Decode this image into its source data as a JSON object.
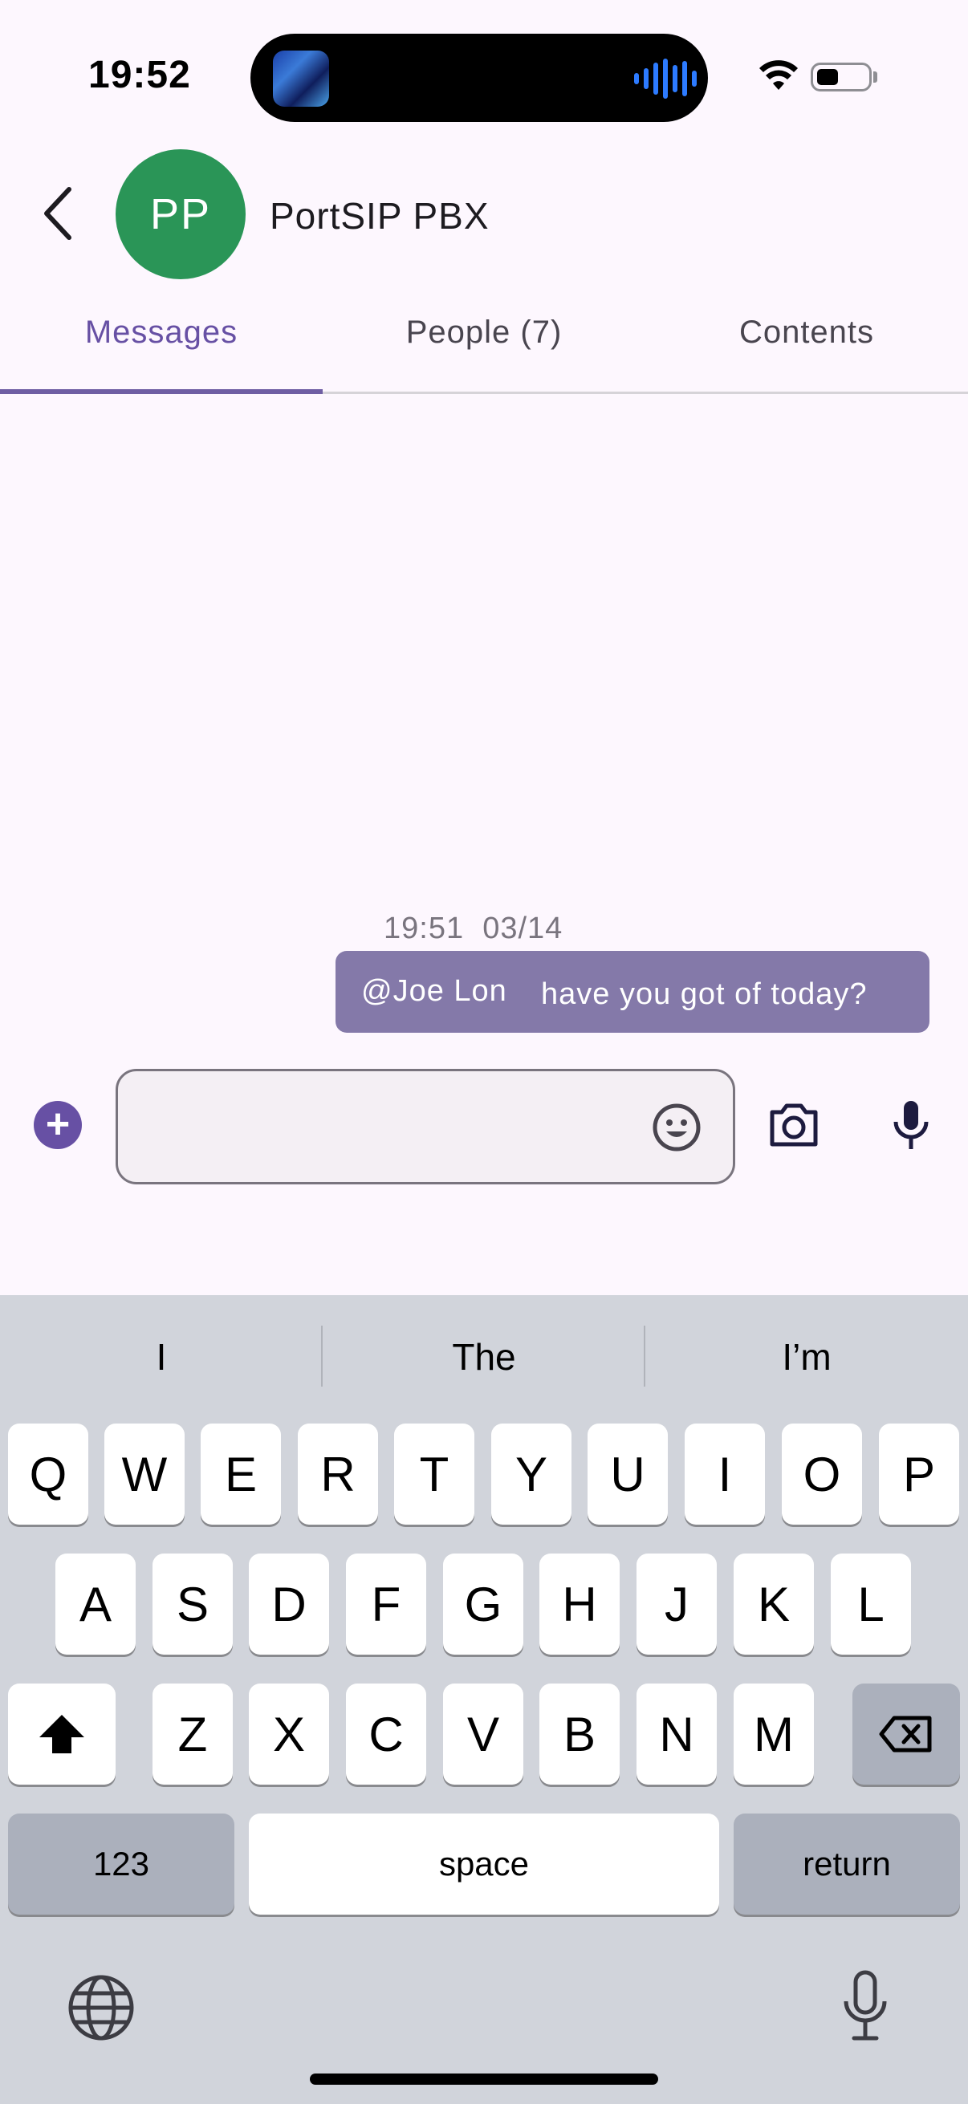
{
  "status_bar": {
    "time": "19:52"
  },
  "header": {
    "back_icon": "chevron-left-icon",
    "avatar_initials": "PP",
    "title": "PortSIP PBX",
    "avatar_color": "#2a9557"
  },
  "tabs": [
    {
      "label": "Messages",
      "selected": true
    },
    {
      "label": "People (7)",
      "selected": false
    },
    {
      "label": "Contents",
      "selected": false
    }
  ],
  "messages": [
    {
      "time": "19:51  03/14",
      "mention": "@Joe Lon",
      "text": "have you got of today?",
      "bubble_color": "#8479a9"
    }
  ],
  "composer": {
    "placeholder": "",
    "icons": [
      "add-icon",
      "emoji-icon",
      "camera-icon",
      "microphone-icon"
    ]
  },
  "keyboard": {
    "suggestions": [
      "I",
      "The",
      "I’m"
    ],
    "row1": [
      "Q",
      "W",
      "E",
      "R",
      "T",
      "Y",
      "U",
      "I",
      "O",
      "P"
    ],
    "row2": [
      "A",
      "S",
      "D",
      "F",
      "G",
      "H",
      "J",
      "K",
      "L"
    ],
    "row3": [
      "Z",
      "X",
      "C",
      "V",
      "B",
      "N",
      "M"
    ],
    "numbers_label": "123",
    "space_label": "space",
    "return_label": "return"
  },
  "colors": {
    "accent": "#6750a4",
    "background": "#fdf7fe",
    "keyboard_bg": "#d1d4db"
  }
}
